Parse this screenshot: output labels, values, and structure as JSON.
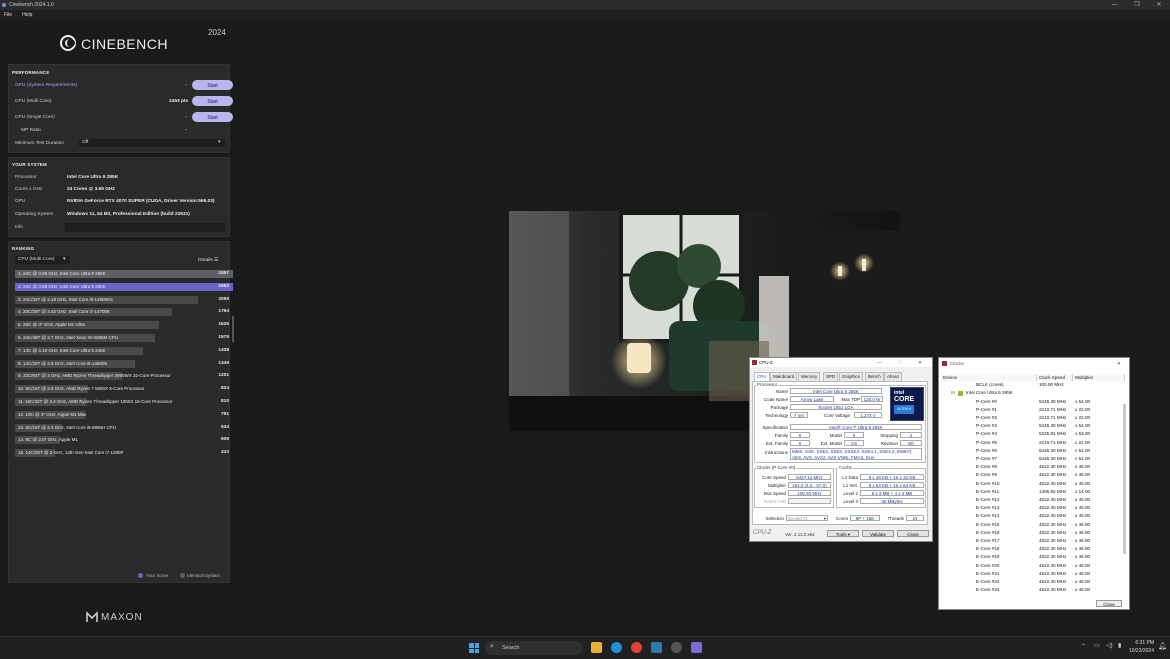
{
  "window": {
    "title": "Cinebench 2024.1.0",
    "menu": [
      "File",
      "Help"
    ]
  },
  "brand": {
    "name": "CINEBENCH",
    "year": "2024",
    "footer": "MAXON"
  },
  "performance": {
    "title": "PERFORMANCE",
    "rows": [
      {
        "label": "GPU (System Requirements)",
        "value": "-",
        "button": "Start"
      },
      {
        "label": "CPU (Multi Core)",
        "value": "2453 pts",
        "button": "Start"
      },
      {
        "label": "CPU (Single Core)",
        "value": "-",
        "button": "Start"
      },
      {
        "label": "MP Ratio",
        "value": "-"
      }
    ],
    "min_test_label": "Minimum Test Duration",
    "min_test_value": "Off"
  },
  "system": {
    "title": "YOUR SYSTEM",
    "rows": [
      {
        "label": "Processor",
        "value": "Intel Core Ultra 9 285K"
      },
      {
        "label": "Cores x GHz",
        "value": "24 Cores @ 3.69 GHz"
      },
      {
        "label": "GPU",
        "value": "NVIDIA GeForce RTX 4070 SUPER (CUDA, Driver Version:566.03)"
      },
      {
        "label": "Operating System",
        "value": "Windows 11, 64 Bit, Professional Edition (build 22631)"
      },
      {
        "label": "Info",
        "value": ""
      }
    ]
  },
  "ranking": {
    "title": "RANKING",
    "dropdown": "CPU (Multi Core)",
    "details": "Details",
    "items": [
      {
        "label": "1. 24C @ 3.69 GHz, Intel Core Ultra 9 285K",
        "score": "2457",
        "value": 2457
      },
      {
        "label": "2. 24C @ 3.69 GHz, Intel Core Ultra 9 285K",
        "score": "2453",
        "value": 2453
      },
      {
        "label": "3. 24C/32T @ 3.19 GHz, Intel Core i9-14900KS",
        "score": "2059",
        "value": 2059
      },
      {
        "label": "4. 20C/28T @ 3.42 GHz, Intel Core i7-14700K",
        "score": "1764",
        "value": 1764
      },
      {
        "label": "5. 20C @ 3* GHz, Apple M1 Ultra",
        "score": "1625",
        "value": 1625
      },
      {
        "label": "6. 24C/48T @ 2.7 GHz, Intel Xeon W-3265M CPU",
        "score": "1579",
        "value": 1579
      },
      {
        "label": "7. 14C @ 4.19 GHz, Intel Core Ultra 5 245K",
        "score": "1438",
        "value": 1438
      },
      {
        "label": "8. 14C/20T @ 3.5 GHz, Intel Core i5-14600K",
        "score": "1349",
        "value": 1349
      },
      {
        "label": "9. 32C/64T @ 3 GHz, AMD Ryzen Threadripper 2990WX 32-Core Processor",
        "score": "1201",
        "value": 1201
      },
      {
        "label": "10. 8C/16T @ 3.8 GHz, AMD Ryzen 7 5800X 8-Core Processor",
        "score": "824",
        "value": 824
      },
      {
        "label": "11. 16C/32T @ 3.4 GHz, AMD Ryzen Threadripper 1950X 16-Core Processor",
        "score": "810",
        "value": 810
      },
      {
        "label": "12. 10C @ 3* GHz, Apple M1 Max",
        "score": "791",
        "value": 791
      },
      {
        "label": "13. 8C/16T @ 2.3 GHz, Intel Core i9-9880H CPU",
        "score": "534",
        "value": 534
      },
      {
        "label": "14. 8C @ 2.5* GHz, Apple M1",
        "score": "509",
        "value": 509
      },
      {
        "label": "15. 14C/20T @ 2 GHz, 12th Gen Intel Core i7-1280P",
        "score": "433",
        "value": 433
      }
    ],
    "legend": {
      "your_score": "Your Score",
      "identical": "Identical System"
    }
  },
  "cpuz": {
    "title": "CPU-Z",
    "tabs": [
      "CPU",
      "Mainboard",
      "Memory",
      "SPD",
      "Graphics",
      "Bench",
      "About"
    ],
    "processor_group": "Processor",
    "name_label": "Name",
    "name": "Intel Core Ultra 9 285K",
    "codename_label": "Code Name",
    "codename": "Arrow Lake",
    "maxtdp_label": "Max TDP",
    "maxtdp": "125.0 W",
    "package_label": "Package",
    "package": "Socket 1851 LGA",
    "tech_label": "Technology",
    "tech": "7 nm",
    "voltage_label": "Core Voltage",
    "voltage": "1.274 V",
    "spec_label": "Specification",
    "spec": "Intel® Core™ Ultra 9 285K",
    "family_label": "Family",
    "family": "6",
    "model_label": "Model",
    "model": "6",
    "stepping_label": "Stepping",
    "stepping": "2",
    "extfamily_label": "Ext. Family",
    "extfamily": "6",
    "extmodel_label": "Ext. Model",
    "extmodel": "C6",
    "revision_label": "Revision",
    "revision": "B0",
    "instr_label": "Instructions",
    "instr": "MMX, SSE, SSE2, SSE3, SSSE3, SSE4.1, SSE4.2, EM64T, AES, AVX, AVX2, AVX-VNNI, FMA3, SHA",
    "clocks_group": "Clocks (P-Core #0)",
    "corespeed_label": "Core Speed",
    "corespeed": "5427.11 MHz",
    "multiplier_label": "Multiplier",
    "multiplier": "x54.0 (4.0 - 57.0)",
    "busspeed_label": "Bus Speed",
    "busspeed": "100.50 MHz",
    "ratedfsb_label": "Rated FSB",
    "cache_group": "Cache",
    "l1d_label": "L1 Data",
    "l1d": "8 x 48 KB + 16 x 32 KB",
    "l1i_label": "L1 Inst.",
    "l1i": "8 x 64 KB + 16 x 64 KB",
    "l2_label": "Level 2",
    "l2": "8 x 3 MB + 4 x 4 MB",
    "l3_label": "Level 3",
    "l3": "36 MBytes",
    "selection_label": "Selection",
    "selection": "Socket #1",
    "cores_label": "Cores",
    "cores": "8P + 16E",
    "threads_label": "Threads",
    "threads": "24",
    "version": "Ver. 2.11.0.x64",
    "tools": "Tools",
    "validate": "Validate",
    "close": "Close",
    "logo_text": "intel CORE ULTRA 9"
  },
  "clocks": {
    "title": "Clocks",
    "headers": [
      "Device",
      "Clock Speed",
      "Multiplier"
    ],
    "bclk": {
      "name": "BCLK (cores)",
      "speed": "100.50 MHz"
    },
    "cpu": "Intel Core Ultra 9 285K",
    "rows": [
      {
        "name": "P-Core #0",
        "speed": "5426.30 MHz",
        "mult": "x 54.00"
      },
      {
        "name": "P-Core #1",
        "speed": "2210.71 MHz",
        "mult": "x 22.00"
      },
      {
        "name": "P-Core #2",
        "speed": "2210.71 MHz",
        "mult": "x 22.00"
      },
      {
        "name": "P-Core #3",
        "speed": "5426.30 MHz",
        "mult": "x 54.00"
      },
      {
        "name": "P-Core #4",
        "speed": "5325.81 MHz",
        "mult": "x 53.00"
      },
      {
        "name": "P-Core #5",
        "speed": "2210.71 MHz",
        "mult": "x 22.00"
      },
      {
        "name": "P-Core #6",
        "speed": "5426.30 MHz",
        "mult": "x 54.00"
      },
      {
        "name": "P-Core #7",
        "speed": "5426.30 MHz",
        "mult": "x 54.00"
      },
      {
        "name": "E-Core #8",
        "speed": "4622.40 MHz",
        "mult": "x 46.00"
      },
      {
        "name": "E-Core #9",
        "speed": "4622.40 MHz",
        "mult": "x 46.00"
      },
      {
        "name": "E-Core #10",
        "speed": "4622.40 MHz",
        "mult": "x 46.00"
      },
      {
        "name": "E-Core #11",
        "speed": "1406.82 MHz",
        "mult": "x 14.00"
      },
      {
        "name": "E-Core #12",
        "speed": "4622.40 MHz",
        "mult": "x 46.00"
      },
      {
        "name": "E-Core #13",
        "speed": "4622.40 MHz",
        "mult": "x 46.00"
      },
      {
        "name": "E-Core #14",
        "speed": "4622.40 MHz",
        "mult": "x 46.00"
      },
      {
        "name": "E-Core #15",
        "speed": "4622.40 MHz",
        "mult": "x 46.00"
      },
      {
        "name": "E-Core #16",
        "speed": "4622.40 MHz",
        "mult": "x 46.00"
      },
      {
        "name": "E-Core #17",
        "speed": "4622.40 MHz",
        "mult": "x 46.00"
      },
      {
        "name": "E-Core #18",
        "speed": "4622.40 MHz",
        "mult": "x 46.00"
      },
      {
        "name": "E-Core #19",
        "speed": "4622.40 MHz",
        "mult": "x 46.00"
      },
      {
        "name": "E-Core #20",
        "speed": "4622.40 MHz",
        "mult": "x 46.00"
      },
      {
        "name": "E-Core #21",
        "speed": "4622.40 MHz",
        "mult": "x 46.00"
      },
      {
        "name": "E-Core #22",
        "speed": "4622.40 MHz",
        "mult": "x 46.00"
      },
      {
        "name": "E-Core #23",
        "speed": "4622.40 MHz",
        "mult": "x 46.00"
      }
    ],
    "close": "Close"
  },
  "taskbar": {
    "search": "Search",
    "time": "6:31 PM",
    "date": "10/23/2024"
  },
  "colors": {
    "accent": "#b9b6f0",
    "highlight": "#6c63c9",
    "panel": "#2a2a2a"
  }
}
